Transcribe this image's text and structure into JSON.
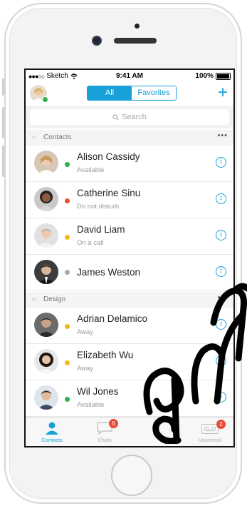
{
  "status_bar": {
    "carrier": "Sketch",
    "time": "9:41 AM",
    "battery": "100%"
  },
  "header": {
    "segments": [
      "All",
      "Favorites"
    ],
    "selected_segment": "All",
    "add_icon": "plus-icon"
  },
  "search": {
    "placeholder": "Search"
  },
  "sections": [
    {
      "title": "Contacts",
      "contacts": [
        {
          "name": "Alison Cassidy",
          "status": "Available",
          "presence_color": "#2bb24a"
        },
        {
          "name": "Catherine Sinu",
          "status": "Do not disturb",
          "presence_color": "#e8502f"
        },
        {
          "name": "David Liam",
          "status": "On a call",
          "presence_color": "#f4b71b"
        },
        {
          "name": "James Weston",
          "status": "",
          "presence_color": "#a8a8a8"
        }
      ]
    },
    {
      "title": "Design",
      "contacts": [
        {
          "name": "Adrian Delamico",
          "status": "Away",
          "presence_color": "#f4b71b"
        },
        {
          "name": "Elizabeth Wu",
          "status": "Away",
          "presence_color": "#f4b71b"
        },
        {
          "name": "Wil Jones",
          "status": "Available",
          "presence_color": "#2bb24a"
        }
      ]
    }
  ],
  "tabbar": [
    {
      "label": "Contacts",
      "icon": "person-icon",
      "active": true,
      "badge": ""
    },
    {
      "label": "Chats",
      "icon": "chat-bubble-icon",
      "active": false,
      "badge": "6"
    },
    {
      "label": "",
      "icon": "",
      "active": false,
      "badge": ""
    },
    {
      "label": "Voicemail",
      "icon": "voicemail-icon",
      "active": false,
      "badge": "2"
    }
  ],
  "colors": {
    "accent": "#18a0d8",
    "badge": "#e84b3a"
  }
}
